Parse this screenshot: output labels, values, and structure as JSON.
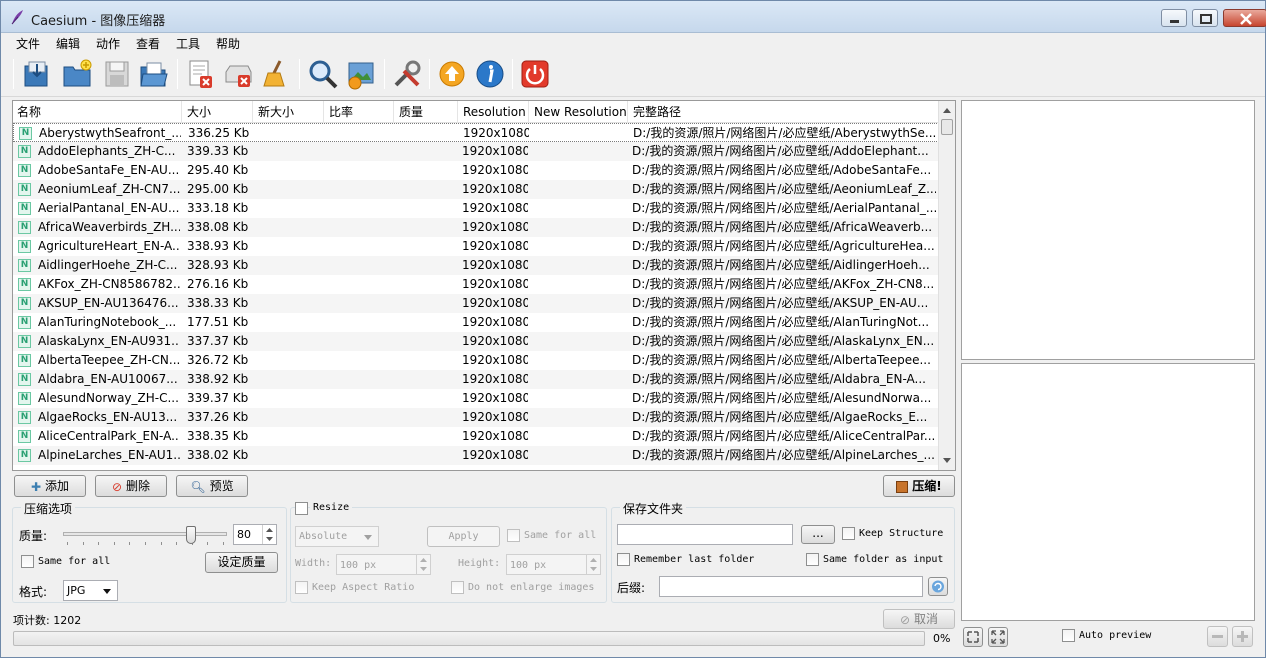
{
  "window": {
    "title": "Caesium - 图像压缩器",
    "icon": "feather-icon",
    "controls": [
      "minimize-icon",
      "maximize-icon",
      "close-icon"
    ]
  },
  "menu": [
    "文件",
    "编辑",
    "动作",
    "查看",
    "工具",
    "帮助"
  ],
  "toolbar": {
    "buttons": [
      {
        "name": "add-pictures",
        "icon": "import-icon"
      },
      {
        "name": "add-folder",
        "icon": "folder-add-icon"
      },
      {
        "name": "save-list",
        "icon": "save-icon"
      },
      {
        "name": "open-list",
        "icon": "open-list-icon"
      },
      {
        "name": "remove-item",
        "icon": "remove-doc-icon"
      },
      {
        "name": "clear-list",
        "icon": "clear-drive-icon"
      },
      {
        "name": "clean",
        "icon": "broom-icon"
      },
      {
        "name": "search",
        "icon": "magnifier-icon"
      },
      {
        "name": "preview-image",
        "icon": "image-gear-icon"
      },
      {
        "name": "settings",
        "icon": "tools-icon"
      },
      {
        "name": "update",
        "icon": "update-icon"
      },
      {
        "name": "about",
        "icon": "info-icon"
      },
      {
        "name": "exit",
        "icon": "power-icon"
      }
    ]
  },
  "table": {
    "columns": [
      "名称",
      "大小",
      "新大小",
      "比率",
      "质量",
      "Resolution",
      "New Resolution",
      "完整路径"
    ],
    "rows": [
      {
        "name": "AberystwythSeafront_...",
        "size": "336.25 Kb",
        "resolution": "1920x1080",
        "path": "D:/我的资源/照片/网络图片/必应壁纸/AberystwythSe..."
      },
      {
        "name": "AddoElephants_ZH-C...",
        "size": "339.33 Kb",
        "resolution": "1920x1080",
        "path": "D:/我的资源/照片/网络图片/必应壁纸/AddoElephant..."
      },
      {
        "name": "AdobeSantaFe_EN-AU...",
        "size": "295.40 Kb",
        "resolution": "1920x1080",
        "path": "D:/我的资源/照片/网络图片/必应壁纸/AdobeSantaFe..."
      },
      {
        "name": "AeoniumLeaf_ZH-CN7...",
        "size": "295.00 Kb",
        "resolution": "1920x1080",
        "path": "D:/我的资源/照片/网络图片/必应壁纸/AeoniumLeaf_Z..."
      },
      {
        "name": "AerialPantanal_EN-AU...",
        "size": "333.18 Kb",
        "resolution": "1920x1080",
        "path": "D:/我的资源/照片/网络图片/必应壁纸/AerialPantanal_..."
      },
      {
        "name": "AfricaWeaverbirds_ZH...",
        "size": "338.08 Kb",
        "resolution": "1920x1080",
        "path": "D:/我的资源/照片/网络图片/必应壁纸/AfricaWeaverb..."
      },
      {
        "name": "AgricultureHeart_EN-A...",
        "size": "338.93 Kb",
        "resolution": "1920x1080",
        "path": "D:/我的资源/照片/网络图片/必应壁纸/AgricultureHea..."
      },
      {
        "name": "AidlingerHoehe_ZH-C...",
        "size": "328.93 Kb",
        "resolution": "1920x1080",
        "path": "D:/我的资源/照片/网络图片/必应壁纸/AidlingerHoeh..."
      },
      {
        "name": "AKFox_ZH-CN8586782...",
        "size": "276.16 Kb",
        "resolution": "1920x1080",
        "path": "D:/我的资源/照片/网络图片/必应壁纸/AKFox_ZH-CN8..."
      },
      {
        "name": "AKSUP_EN-AU136476...",
        "size": "338.33 Kb",
        "resolution": "1920x1080",
        "path": "D:/我的资源/照片/网络图片/必应壁纸/AKSUP_EN-AU..."
      },
      {
        "name": "AlanTuringNotebook_...",
        "size": "177.51 Kb",
        "resolution": "1920x1080",
        "path": "D:/我的资源/照片/网络图片/必应壁纸/AlanTuringNot..."
      },
      {
        "name": "AlaskaLynx_EN-AU931...",
        "size": "337.37 Kb",
        "resolution": "1920x1080",
        "path": "D:/我的资源/照片/网络图片/必应壁纸/AlaskaLynx_EN..."
      },
      {
        "name": "AlbertaTeepee_ZH-CN...",
        "size": "326.72 Kb",
        "resolution": "1920x1080",
        "path": "D:/我的资源/照片/网络图片/必应壁纸/AlbertaTeepee..."
      },
      {
        "name": "Aldabra_EN-AU10067...",
        "size": "338.92 Kb",
        "resolution": "1920x1080",
        "path": "D:/我的资源/照片/网络图片/必应壁纸/Aldabra_EN-A..."
      },
      {
        "name": "AlesundNorway_ZH-C...",
        "size": "339.37 Kb",
        "resolution": "1920x1080",
        "path": "D:/我的资源/照片/网络图片/必应壁纸/AlesundNorwa..."
      },
      {
        "name": "AlgaeRocks_EN-AU13...",
        "size": "337.26 Kb",
        "resolution": "1920x1080",
        "path": "D:/我的资源/照片/网络图片/必应壁纸/AlgaeRocks_E..."
      },
      {
        "name": "AliceCentralPark_EN-A...",
        "size": "338.35 Kb",
        "resolution": "1920x1080",
        "path": "D:/我的资源/照片/网络图片/必应壁纸/AliceCentralPar..."
      },
      {
        "name": "AlpineLarches_EN-AU1...",
        "size": "338.02 Kb",
        "resolution": "1920x1080",
        "path": "D:/我的资源/照片/网络图片/必应壁纸/AlpineLarches_..."
      }
    ]
  },
  "list_buttons": {
    "add": "添加",
    "remove": "删除",
    "preview": "预览",
    "compress": "压缩!"
  },
  "compression": {
    "title": "压缩选项",
    "quality_label": "质量:",
    "quality_value": "80",
    "quality_level": 0.8,
    "same_for_all": "Same for all",
    "set_quality": "设定质量",
    "format_label": "格式:",
    "format_value": "JPG"
  },
  "resize": {
    "title": "Resize",
    "mode": "Absolute",
    "apply": "Apply",
    "same_for_all": "Same for all",
    "width_label": "Width:",
    "width_value": "100 px",
    "height_label": "Height:",
    "height_value": "100 px",
    "keep_aspect": "Keep Aspect Ratio",
    "no_enlarge": "Do not enlarge images"
  },
  "output": {
    "title": "保存文件夹",
    "browse": "...",
    "keep_structure": "Keep Structure",
    "remember_last": "Remember last folder",
    "same_folder": "Same folder as input",
    "suffix_label": "后缀:"
  },
  "status": {
    "item_count": "项计数: 1202",
    "cancel": "取消",
    "progress_text": "0%",
    "progress_fraction": 0
  },
  "preview": {
    "auto_preview": "Auto preview"
  },
  "colors": {
    "accent": "#3c7fb1",
    "title_bg": "#c6d8ec",
    "close_btn": "#c7452f",
    "file_icon": "#2aa073"
  }
}
